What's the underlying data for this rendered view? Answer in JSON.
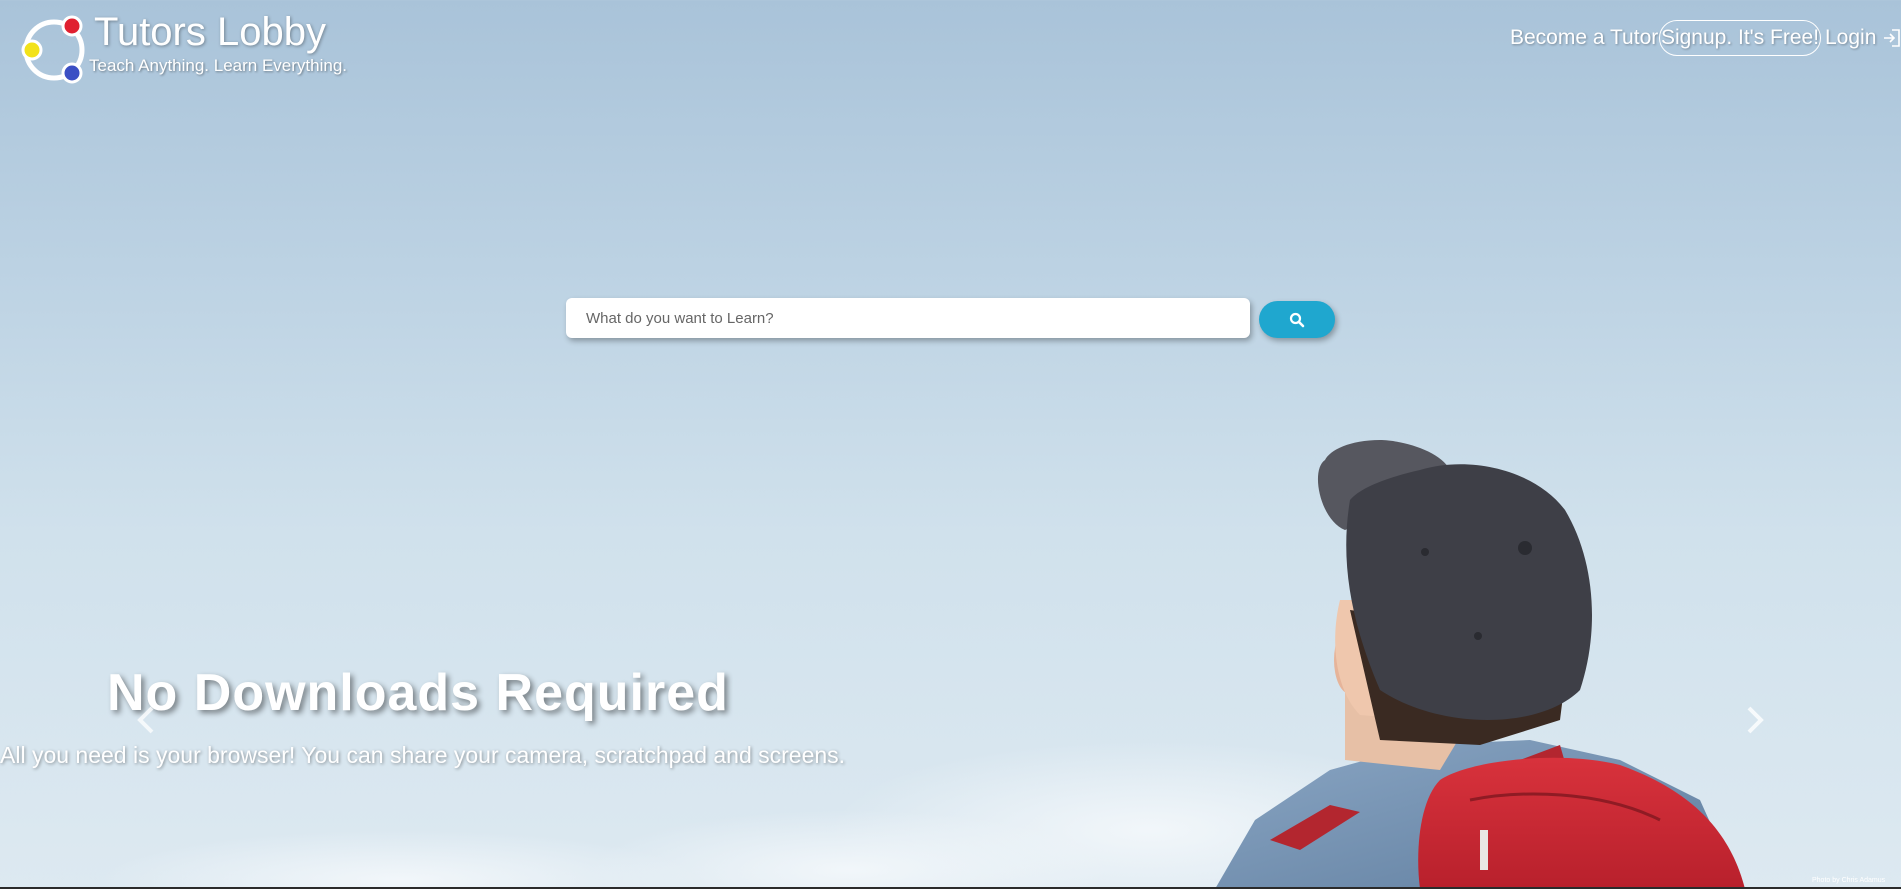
{
  "header": {
    "brand_name": "Tutors Lobby",
    "tagline": "Teach Anything. Learn Everything.",
    "logo_colors": {
      "red": "#e02030",
      "yellow": "#f2e21a",
      "blue": "#3b4fc4"
    },
    "nav": {
      "become_tutor": "Become a Tutor",
      "signup": "Signup. It's Free!",
      "login": "Login"
    }
  },
  "search": {
    "placeholder": "What do you want to Learn?",
    "button_icon": "search-icon",
    "button_color": "#1fa7cf"
  },
  "carousel": {
    "title": "No Downloads Required",
    "text": "All you need is your browser! You can share your camera, scratchpad and screens.",
    "prev_icon": "chevron-left-icon",
    "next_icon": "chevron-right-icon",
    "photo_credit": "Photo by Chris Adamus"
  }
}
